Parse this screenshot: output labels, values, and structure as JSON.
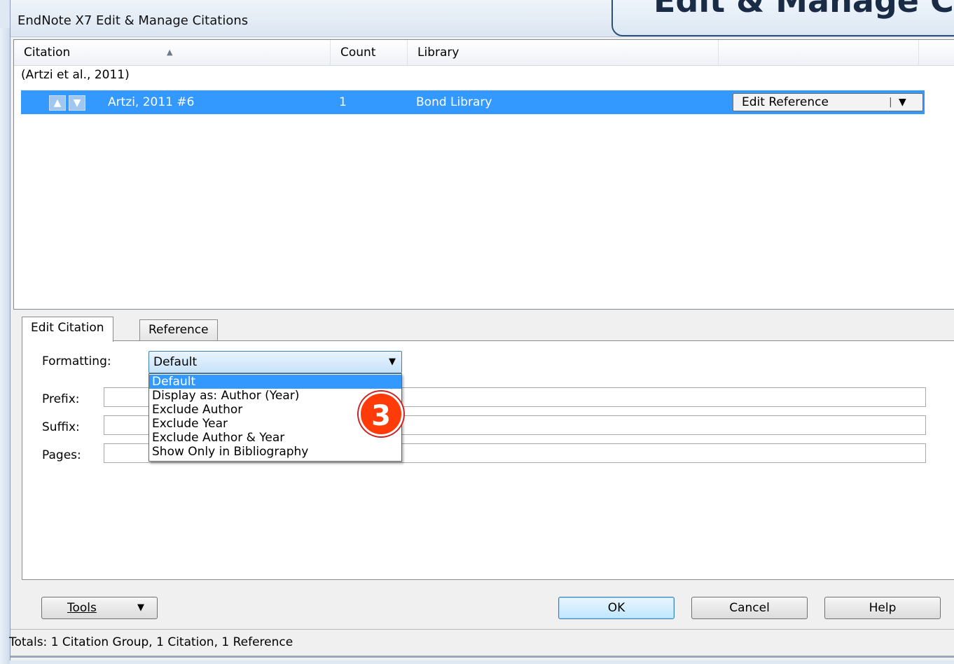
{
  "window": {
    "title": "EndNote X7 Edit & Manage Citations"
  },
  "banner": {
    "text": "Edit & Manage C"
  },
  "list": {
    "columns": [
      "Citation",
      "Count",
      "Library"
    ],
    "group_label": "(Artzi et al., 2011)",
    "selected_row": {
      "citation": "Artzi, 2011 #6",
      "count": "1",
      "library": "Bond Library",
      "edit_button": "Edit Reference"
    }
  },
  "tabs": [
    "Edit Citation",
    "Reference"
  ],
  "form": {
    "formatting_label": "Formatting:",
    "formatting_value": "Default",
    "prefix_label": "Prefix:",
    "suffix_label": "Suffix:",
    "pages_label": "Pages:",
    "prefix_value": "",
    "suffix_value": "",
    "pages_value": ""
  },
  "dropdown_options": [
    "Default",
    "Display as: Author (Year)",
    "Exclude Author",
    "Exclude Year",
    "Exclude Author & Year",
    "Show Only in Bibliography"
  ],
  "step_badge": "3",
  "buttons": {
    "tools": "Tools",
    "ok": "OK",
    "cancel": "Cancel",
    "help": "Help"
  },
  "status": "Totals: 1 Citation Group, 1 Citation, 1 Reference",
  "colors": {
    "selection": "#3399ff",
    "badge": "#ff3b0a",
    "banner_text": "#1a2b45"
  }
}
